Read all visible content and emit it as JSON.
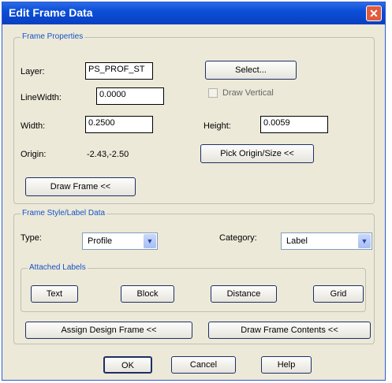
{
  "window": {
    "title": "Edit Frame Data",
    "close_icon": "close-icon"
  },
  "frame_properties": {
    "legend": "Frame Properties",
    "layer_label": "Layer:",
    "layer_value": "PS_PROF_ST",
    "select_button": "Select...",
    "linewidth_label": "LineWidth:",
    "linewidth_value": "0.0000",
    "draw_vertical_label": "Draw Vertical",
    "width_label": "Width:",
    "width_value": "0.2500",
    "height_label": "Height:",
    "height_value": "0.0059",
    "origin_label": "Origin:",
    "origin_value": "-2.43,-2.50",
    "pick_origin_button": "Pick Origin/Size <<",
    "draw_frame_button": "Draw Frame <<"
  },
  "style_label": {
    "legend": "Frame Style/Label Data",
    "type_label": "Type:",
    "type_value": "Profile",
    "category_label": "Category:",
    "category_value": "Label",
    "attached_legend": "Attached Labels",
    "text_button": "Text",
    "block_button": "Block",
    "distance_button": "Distance",
    "grid_button": "Grid",
    "assign_button": "Assign Design Frame <<",
    "draw_contents_button": "Draw Frame Contents <<"
  },
  "footer": {
    "ok": "OK",
    "cancel": "Cancel",
    "help": "Help"
  }
}
